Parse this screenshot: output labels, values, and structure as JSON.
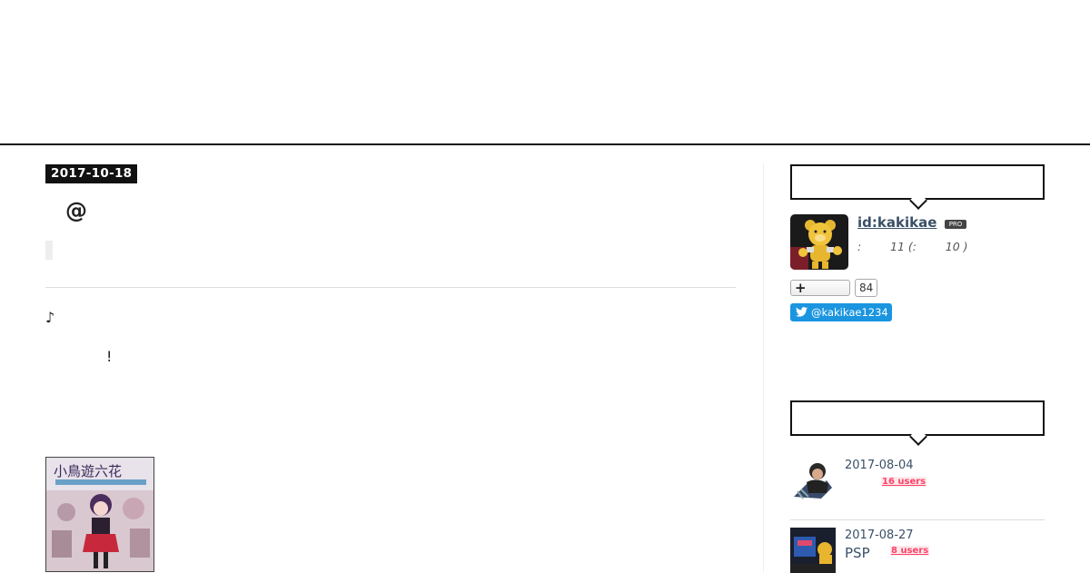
{
  "entry": {
    "date": "2017-10-18",
    "title": "@",
    "body_line_1": "♪",
    "body_line_2": "!"
  },
  "profile": {
    "user_id": "id:kakikae",
    "pro_label": "PRO",
    "stats": ":        11 (:        10 )",
    "bookmark_count": "84",
    "twitter_handle": "@kakikae1234"
  },
  "recent_entries": [
    {
      "date": "2017-08-04",
      "title": "",
      "users": "16 users"
    },
    {
      "date": "2017-08-27",
      "title": "PSP",
      "users": "8 users"
    }
  ],
  "colors": {
    "accent_link": "#3b5066",
    "twitter_blue": "#1b95e0",
    "users_badge": "#ff4166"
  }
}
